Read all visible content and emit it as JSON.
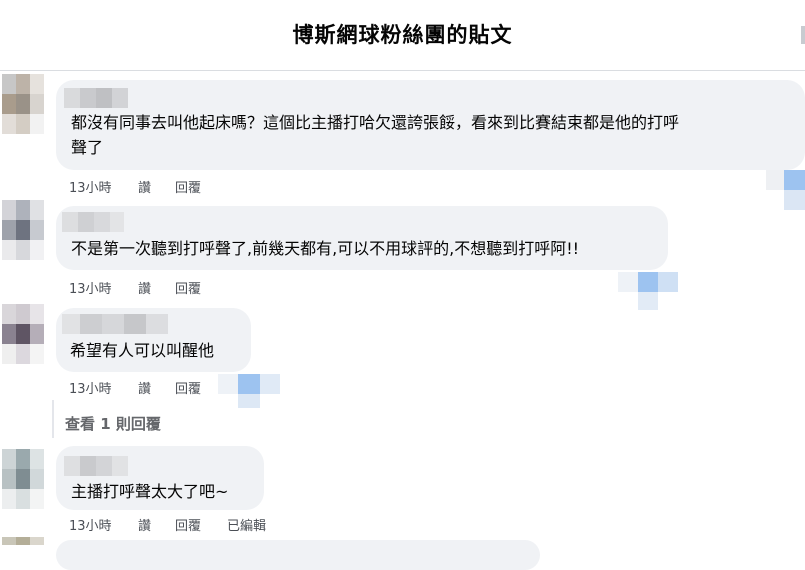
{
  "header": {
    "title": "博斯網球粉絲團的貼文"
  },
  "comments": [
    {
      "text_lines": [
        "都沒有同事去叫他起床嗎？這個比主播打哈欠還誇張餒，看來到比賽結束都是他的打呼",
        "聲了"
      ],
      "time": "13小時",
      "like_label": "讚",
      "reply_label": "回覆"
    },
    {
      "text_lines": [
        "不是第一次聽到打呼聲了,前幾天都有,可以不用球評的,不想聽到打呼阿!!"
      ],
      "time": "13小時",
      "like_label": "讚",
      "reply_label": "回覆"
    },
    {
      "text_lines": [
        "希望有人可以叫醒他"
      ],
      "time": "13小時",
      "like_label": "讚",
      "reply_label": "回覆",
      "view_replies": "查看 1 則回覆"
    },
    {
      "text_lines": [
        "主播打呼聲太大了吧~"
      ],
      "time": "13小時",
      "like_label": "讚",
      "reply_label": "回覆",
      "edited_label": "已編輯"
    }
  ],
  "colors": {
    "bubble": "#f0f2f5",
    "meta_text": "#65676b",
    "avatar_1": [
      "#c7c7c7",
      "#9a9288",
      "#a99c8c",
      "#d8d4cf",
      "#e2ddd8",
      "#bdb3a8",
      "#e8e8e8",
      "#d4cdc4",
      "#f2f2f2"
    ],
    "avatar_2": [
      "#d3d3d8",
      "#8a8e9a",
      "#aeb2bb",
      "#9ea2ab",
      "#6e7380",
      "#c7cad0",
      "#eaeaec",
      "#d7d8dc",
      "#f1f1f3"
    ],
    "avatar_3": [
      "#d9d6da",
      "#a7a2ab",
      "#cfcad0",
      "#8a8290",
      "#5f5564",
      "#b5aeb8",
      "#efefef",
      "#dcd8de",
      "#f4f4f4"
    ],
    "avatar_4": [
      "#cdd4d6",
      "#8c9ba0",
      "#9aa9ad",
      "#b8c1c3",
      "#7f8d92",
      "#d1d8da",
      "#eceeef",
      "#d9dfe0",
      "#f3f4f4"
    ],
    "redaction_blue": "#9dc3f0"
  },
  "icons": {
    "redaction": "pixelated-redaction"
  }
}
